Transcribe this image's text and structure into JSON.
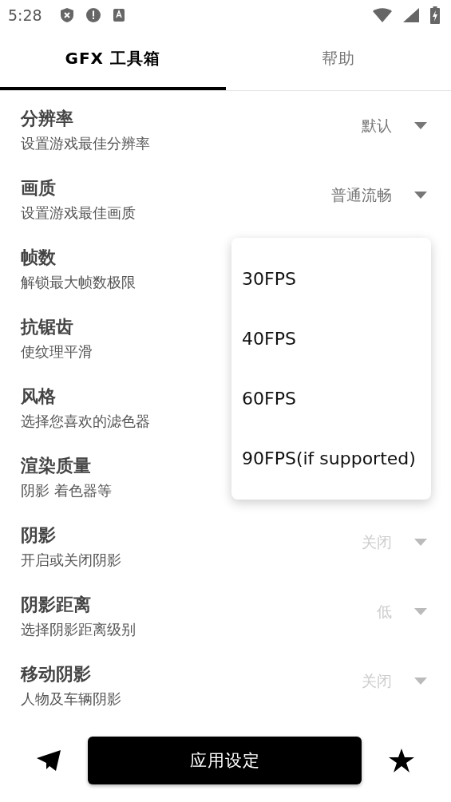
{
  "status_bar": {
    "time": "5:28"
  },
  "tabs": [
    {
      "label": "GFX 工具箱",
      "selected": true
    },
    {
      "label": "帮助",
      "selected": false
    }
  ],
  "settings": [
    {
      "title": "分辨率",
      "subtitle": "设置游戏最佳分辨率",
      "value": "默认",
      "disabled": false
    },
    {
      "title": "画质",
      "subtitle": "设置游戏最佳画质",
      "value": "普通流畅",
      "disabled": false
    },
    {
      "title": "帧数",
      "subtitle": "解锁最大帧数极限"
    },
    {
      "title": "抗锯齿",
      "subtitle": "使纹理平滑"
    },
    {
      "title": "风格",
      "subtitle": "选择您喜欢的滤色器"
    },
    {
      "title": "渲染质量",
      "subtitle": "阴影 着色器等"
    },
    {
      "title": "阴影",
      "subtitle": "开启或关闭阴影",
      "value": "关闭",
      "disabled": true
    },
    {
      "title": "阴影距离",
      "subtitle": "选择阴影距离级别",
      "value": "低",
      "disabled": true
    },
    {
      "title": "移动阴影",
      "subtitle": "人物及车辆阴影",
      "value": "关闭",
      "disabled": true
    }
  ],
  "dropdown_menu": {
    "items": [
      "30FPS",
      "40FPS",
      "60FPS",
      "90FPS(if supported)"
    ]
  },
  "apply_button": "应用设定"
}
